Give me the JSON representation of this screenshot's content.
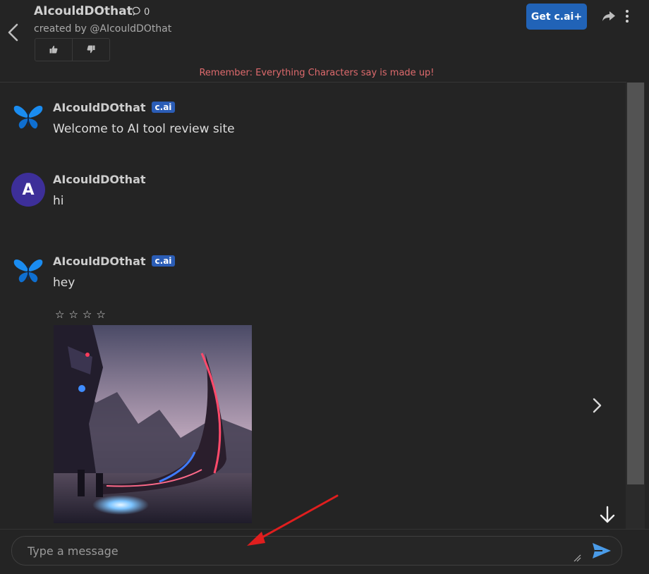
{
  "header": {
    "character_name": "AIcouldDOthat",
    "chat_count": "0",
    "created_by": "created by @AIcouldDOthat",
    "upgrade_label": "Get c.ai+"
  },
  "disclaimer": "Remember: Everything Characters say is made up!",
  "messages": [
    {
      "author": "AIcouldDOthat",
      "badge": "c.ai",
      "text": "Welcome to AI tool review site",
      "avatar_icon": "butterfly-icon"
    },
    {
      "author": "AIcouldDOthat",
      "avatar_letter": "A",
      "text": "hi"
    },
    {
      "author": "AIcouldDOthat",
      "badge": "c.ai",
      "text": "hey",
      "avatar_icon": "butterfly-icon",
      "rating_stars": "☆☆☆☆",
      "has_image": true
    }
  ],
  "composer": {
    "placeholder": "Type a message"
  },
  "colors": {
    "background": "#242424",
    "accent": "#2163b7",
    "disclaimer": "#de6a6d",
    "annotation_arrow": "#e01e1e"
  }
}
